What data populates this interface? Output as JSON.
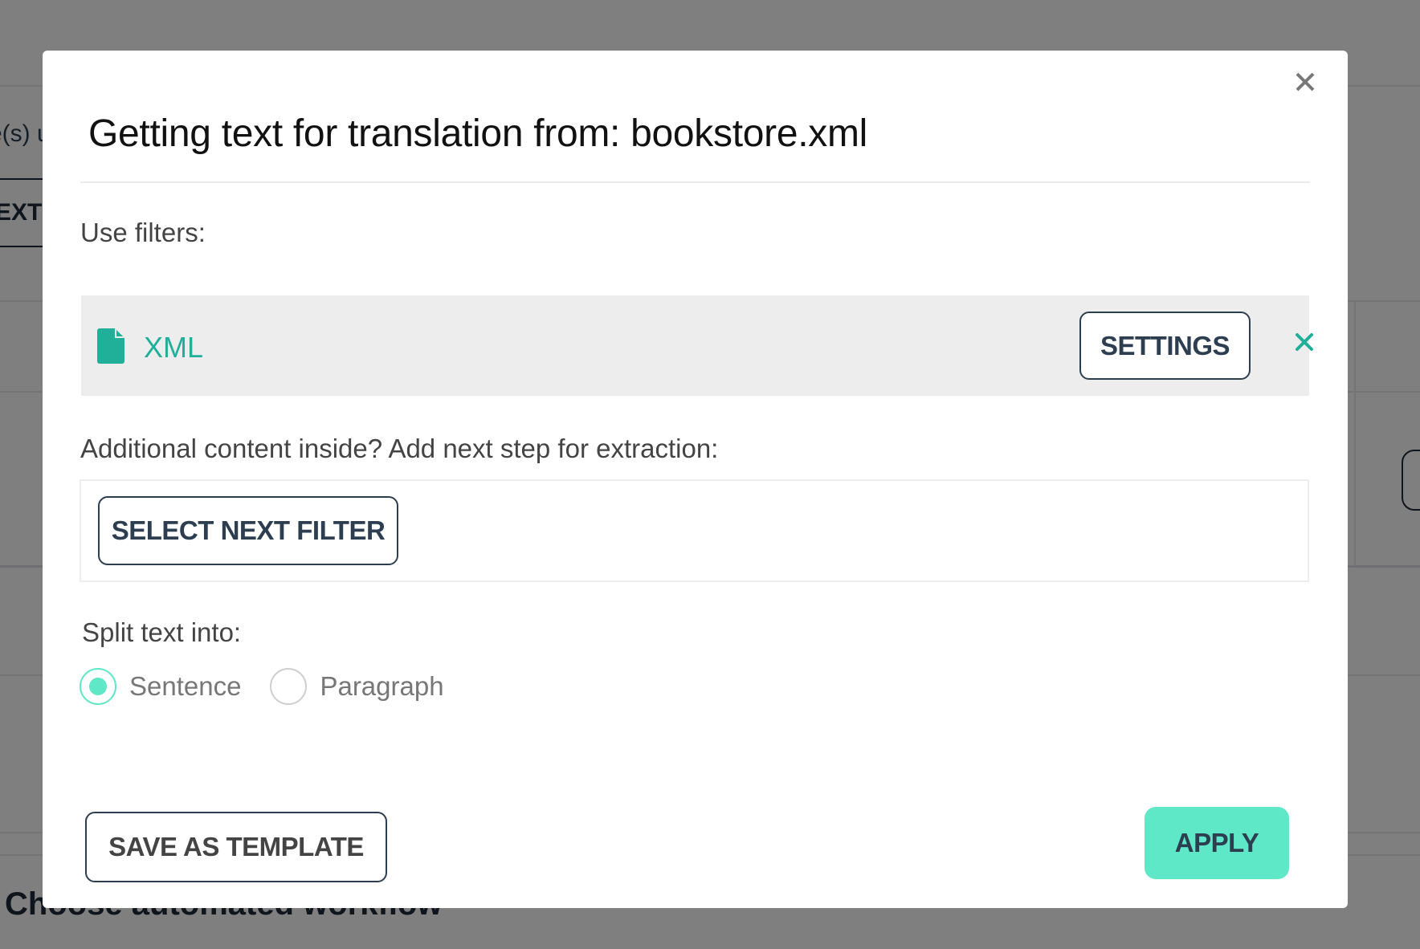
{
  "background": {
    "partial_upload_text": "e(s) u",
    "partial_tab_label": "EXT",
    "partial_heading": "Choose automated workflow"
  },
  "modal": {
    "title": "Getting text for translation from: bookstore.xml",
    "close_icon": "close-icon",
    "use_filters_label": "Use filters:",
    "filters": [
      {
        "icon": "file-icon",
        "name": "XML",
        "settings_label": "SETTINGS",
        "remove_icon": "remove-icon"
      }
    ],
    "additional_label": "Additional content inside? Add next step for extraction:",
    "select_next_filter_label": "SELECT NEXT FILTER",
    "split_label": "Split text into:",
    "split_options": [
      {
        "label": "Sentence",
        "checked": true
      },
      {
        "label": "Paragraph",
        "checked": false
      }
    ],
    "save_template_label": "SAVE AS TEMPLATE",
    "apply_label": "APPLY"
  },
  "colors": {
    "accent": "#5ee8c7",
    "filter_teal": "#20b09a",
    "button_text": "#2c3e50",
    "overlay": "#808080"
  }
}
